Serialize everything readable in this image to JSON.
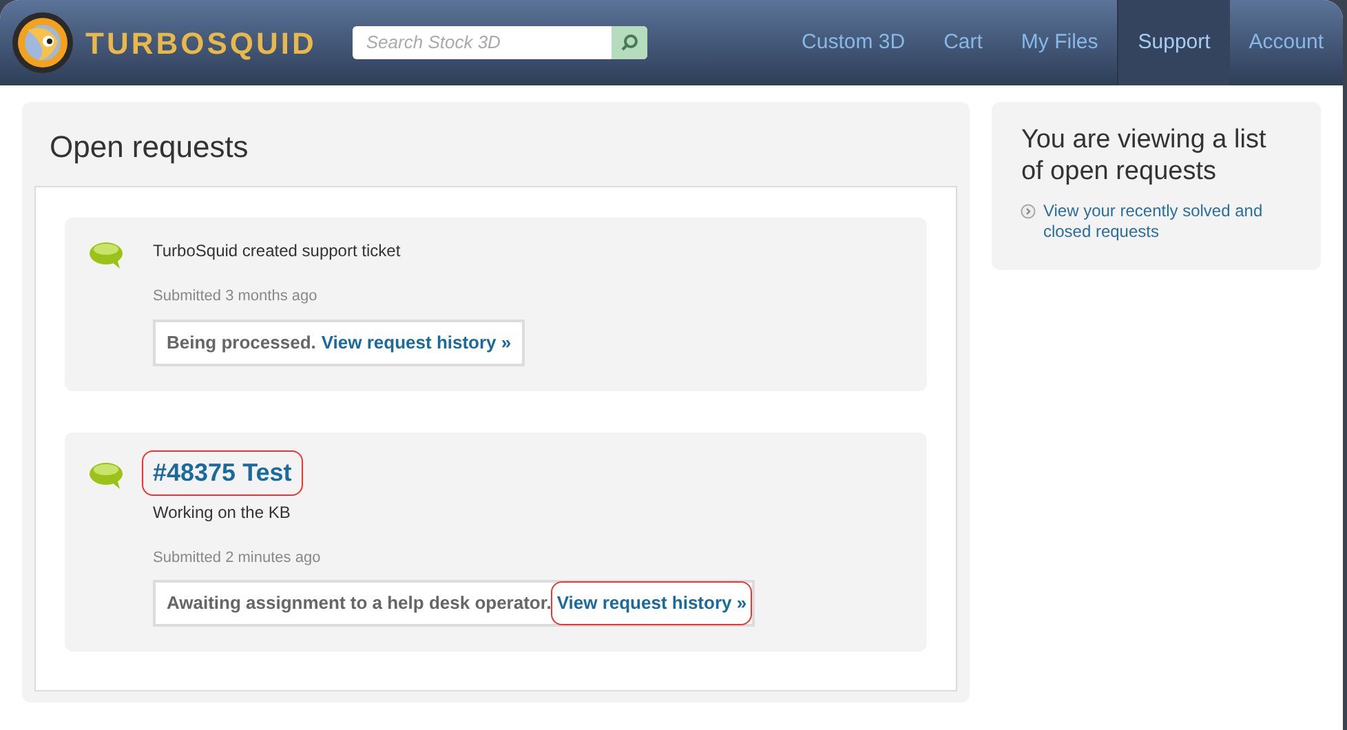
{
  "header": {
    "logo": "TURBOSQUID",
    "search": {
      "placeholder": "Search Stock 3D"
    },
    "nav": [
      {
        "label": "Custom 3D",
        "selected": false
      },
      {
        "label": "Cart",
        "selected": false
      },
      {
        "label": "My Files",
        "selected": false
      },
      {
        "label": "Support",
        "selected": true
      },
      {
        "label": "Account",
        "selected": false
      }
    ]
  },
  "main": {
    "title": "Open requests",
    "requests": [
      {
        "description": "TurboSquid created support ticket",
        "submitted": "Submitted 3 months ago",
        "status": "Being processed.",
        "link": "View request history »",
        "link_highlighted": false
      },
      {
        "title": "#48375 Test",
        "title_highlighted": true,
        "description": "Working on the KB",
        "submitted": "Submitted 2 minutes ago",
        "status": "Awaiting assignment to a help desk operator.",
        "link": "View request history »",
        "link_highlighted": true
      }
    ]
  },
  "sidebar": {
    "heading": "You are viewing a list of open requests",
    "link": "View your recently solved and closed requests"
  }
}
